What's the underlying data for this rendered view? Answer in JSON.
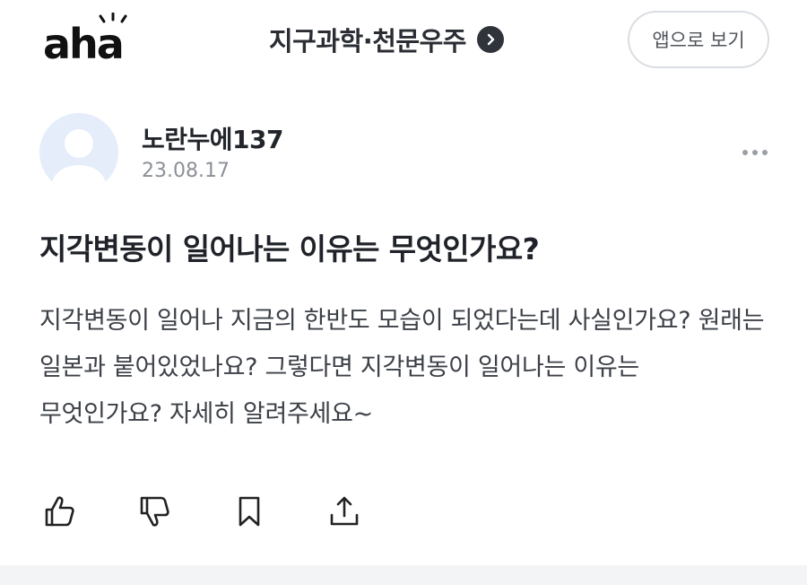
{
  "header": {
    "logo_text": "aha",
    "category_label": "지구과학·천문우주",
    "category_icon": "chevron-right-circle-icon",
    "app_button_label": "앱으로 보기"
  },
  "author": {
    "name": "노란누에137",
    "date": "23.08.17",
    "avatar_icon": "default-avatar-icon",
    "more_icon": "more-horizontal-icon"
  },
  "question": {
    "title": "지각변동이 일어나는 이유는 무엇인가요?",
    "body": "지각변동이 일어나 지금의 한반도 모습이 되었다는데 사실인가요? 원래는 일본과 붙어있었나요? 그렇다면 지각변동이 일어나는 이유는 무엇인가요? 자세히 알려주세요~"
  },
  "actions": [
    {
      "icon": "thumbs-up-icon"
    },
    {
      "icon": "thumbs-down-icon"
    },
    {
      "icon": "bookmark-icon"
    },
    {
      "icon": "share-icon"
    }
  ],
  "colors": {
    "text_primary": "#1f2228",
    "text_secondary": "#8c9097",
    "avatar_bg": "#e4edf9",
    "button_border": "#dadde2",
    "divider": "#f3f4f6"
  }
}
